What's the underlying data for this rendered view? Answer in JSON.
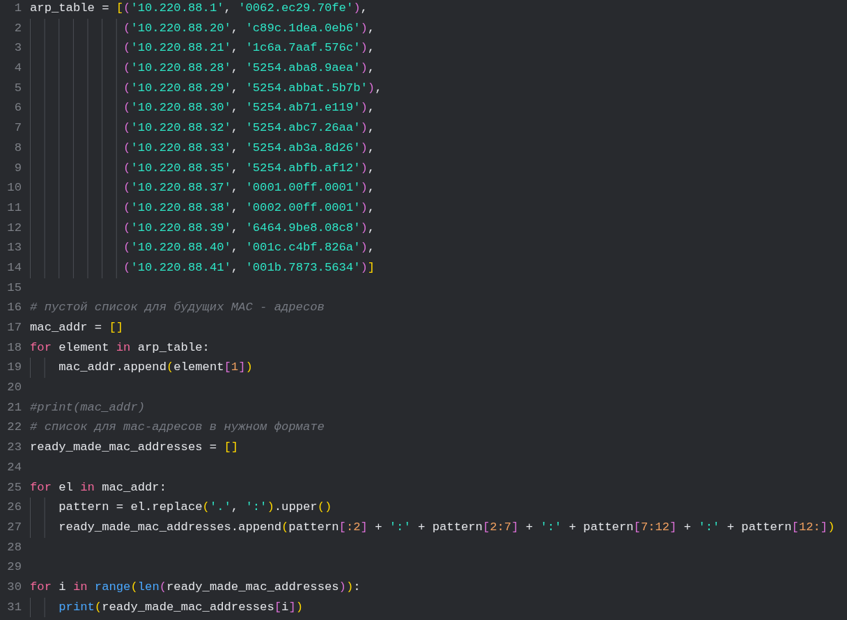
{
  "editor": {
    "lines": [
      {
        "number": "1",
        "tokens": [
          {
            "kind": "plain",
            "text": "arp_table = "
          },
          {
            "kind": "bracket1",
            "text": "["
          },
          {
            "kind": "bracket2",
            "text": "("
          },
          {
            "kind": "string",
            "text": "'10.220.88.1'"
          },
          {
            "kind": "plain",
            "text": ", "
          },
          {
            "kind": "string",
            "text": "'0062.ec29.70fe'"
          },
          {
            "kind": "bracket2",
            "text": ")"
          },
          {
            "kind": "plain",
            "text": ","
          }
        ]
      },
      {
        "number": "2",
        "tokens": [
          {
            "kind": "bracket2",
            "text": "             ("
          },
          {
            "kind": "string",
            "text": "'10.220.88.20'"
          },
          {
            "kind": "plain",
            "text": ", "
          },
          {
            "kind": "string",
            "text": "'c89c.1dea.0eb6'"
          },
          {
            "kind": "bracket2",
            "text": ")"
          },
          {
            "kind": "plain",
            "text": ","
          }
        ]
      },
      {
        "number": "3",
        "tokens": [
          {
            "kind": "bracket2",
            "text": "             ("
          },
          {
            "kind": "string",
            "text": "'10.220.88.21'"
          },
          {
            "kind": "plain",
            "text": ", "
          },
          {
            "kind": "string",
            "text": "'1c6a.7aaf.576c'"
          },
          {
            "kind": "bracket2",
            "text": ")"
          },
          {
            "kind": "plain",
            "text": ","
          }
        ]
      },
      {
        "number": "4",
        "tokens": [
          {
            "kind": "bracket2",
            "text": "             ("
          },
          {
            "kind": "string",
            "text": "'10.220.88.28'"
          },
          {
            "kind": "plain",
            "text": ", "
          },
          {
            "kind": "string",
            "text": "'5254.aba8.9aea'"
          },
          {
            "kind": "bracket2",
            "text": ")"
          },
          {
            "kind": "plain",
            "text": ","
          }
        ]
      },
      {
        "number": "5",
        "tokens": [
          {
            "kind": "bracket2",
            "text": "             ("
          },
          {
            "kind": "string",
            "text": "'10.220.88.29'"
          },
          {
            "kind": "plain",
            "text": ", "
          },
          {
            "kind": "string",
            "text": "'5254.abbat.5b7b'"
          },
          {
            "kind": "bracket2",
            "text": ")"
          },
          {
            "kind": "plain",
            "text": ","
          }
        ]
      },
      {
        "number": "6",
        "tokens": [
          {
            "kind": "bracket2",
            "text": "             ("
          },
          {
            "kind": "string",
            "text": "'10.220.88.30'"
          },
          {
            "kind": "plain",
            "text": ", "
          },
          {
            "kind": "string",
            "text": "'5254.ab71.e119'"
          },
          {
            "kind": "bracket2",
            "text": ")"
          },
          {
            "kind": "plain",
            "text": ","
          }
        ]
      },
      {
        "number": "7",
        "tokens": [
          {
            "kind": "bracket2",
            "text": "             ("
          },
          {
            "kind": "string",
            "text": "'10.220.88.32'"
          },
          {
            "kind": "plain",
            "text": ", "
          },
          {
            "kind": "string",
            "text": "'5254.abc7.26aa'"
          },
          {
            "kind": "bracket2",
            "text": ")"
          },
          {
            "kind": "plain",
            "text": ","
          }
        ]
      },
      {
        "number": "8",
        "tokens": [
          {
            "kind": "bracket2",
            "text": "             ("
          },
          {
            "kind": "string",
            "text": "'10.220.88.33'"
          },
          {
            "kind": "plain",
            "text": ", "
          },
          {
            "kind": "string",
            "text": "'5254.ab3a.8d26'"
          },
          {
            "kind": "bracket2",
            "text": ")"
          },
          {
            "kind": "plain",
            "text": ","
          }
        ]
      },
      {
        "number": "9",
        "tokens": [
          {
            "kind": "bracket2",
            "text": "             ("
          },
          {
            "kind": "string",
            "text": "'10.220.88.35'"
          },
          {
            "kind": "plain",
            "text": ", "
          },
          {
            "kind": "string",
            "text": "'5254.abfb.af12'"
          },
          {
            "kind": "bracket2",
            "text": ")"
          },
          {
            "kind": "plain",
            "text": ","
          }
        ]
      },
      {
        "number": "10",
        "tokens": [
          {
            "kind": "bracket2",
            "text": "             ("
          },
          {
            "kind": "string",
            "text": "'10.220.88.37'"
          },
          {
            "kind": "plain",
            "text": ", "
          },
          {
            "kind": "string",
            "text": "'0001.00ff.0001'"
          },
          {
            "kind": "bracket2",
            "text": ")"
          },
          {
            "kind": "plain",
            "text": ","
          }
        ]
      },
      {
        "number": "11",
        "tokens": [
          {
            "kind": "bracket2",
            "text": "             ("
          },
          {
            "kind": "string",
            "text": "'10.220.88.38'"
          },
          {
            "kind": "plain",
            "text": ", "
          },
          {
            "kind": "string",
            "text": "'0002.00ff.0001'"
          },
          {
            "kind": "bracket2",
            "text": ")"
          },
          {
            "kind": "plain",
            "text": ","
          }
        ]
      },
      {
        "number": "12",
        "tokens": [
          {
            "kind": "bracket2",
            "text": "             ("
          },
          {
            "kind": "string",
            "text": "'10.220.88.39'"
          },
          {
            "kind": "plain",
            "text": ", "
          },
          {
            "kind": "string",
            "text": "'6464.9be8.08c8'"
          },
          {
            "kind": "bracket2",
            "text": ")"
          },
          {
            "kind": "plain",
            "text": ","
          }
        ]
      },
      {
        "number": "13",
        "tokens": [
          {
            "kind": "bracket2",
            "text": "             ("
          },
          {
            "kind": "string",
            "text": "'10.220.88.40'"
          },
          {
            "kind": "plain",
            "text": ", "
          },
          {
            "kind": "string",
            "text": "'001c.c4bf.826a'"
          },
          {
            "kind": "bracket2",
            "text": ")"
          },
          {
            "kind": "plain",
            "text": ","
          }
        ]
      },
      {
        "number": "14",
        "tokens": [
          {
            "kind": "bracket2",
            "text": "             ("
          },
          {
            "kind": "string",
            "text": "'10.220.88.41'"
          },
          {
            "kind": "plain",
            "text": ", "
          },
          {
            "kind": "string",
            "text": "'001b.7873.5634'"
          },
          {
            "kind": "bracket2",
            "text": ")"
          },
          {
            "kind": "bracket1",
            "text": "]"
          }
        ]
      },
      {
        "number": "15"
      },
      {
        "number": "16",
        "tokens": [
          {
            "kind": "comment",
            "text": "# пустой список для будущих MAC - адресов"
          }
        ]
      },
      {
        "number": "17",
        "tokens": [
          {
            "kind": "plain",
            "text": "mac_addr = "
          },
          {
            "kind": "bracket1",
            "text": "[]"
          }
        ]
      },
      {
        "number": "18",
        "tokens": [
          {
            "kind": "keyword",
            "text": "for"
          },
          {
            "kind": "plain",
            "text": " element "
          },
          {
            "kind": "keyword",
            "text": "in"
          },
          {
            "kind": "plain",
            "text": " arp_table:"
          }
        ]
      },
      {
        "number": "19",
        "tokens": [
          {
            "kind": "plain",
            "text": "    mac_addr.append"
          },
          {
            "kind": "bracket1",
            "text": "("
          },
          {
            "kind": "plain",
            "text": "element"
          },
          {
            "kind": "bracket2",
            "text": "["
          },
          {
            "kind": "number",
            "text": "1"
          },
          {
            "kind": "bracket2",
            "text": "]"
          },
          {
            "kind": "bracket1",
            "text": ")"
          }
        ]
      },
      {
        "number": "20"
      },
      {
        "number": "21",
        "tokens": [
          {
            "kind": "comment",
            "text": "#print(mac_addr)"
          }
        ]
      },
      {
        "number": "22",
        "tokens": [
          {
            "kind": "comment",
            "text": "# список для mac-адресов в нужном формате"
          }
        ]
      },
      {
        "number": "23",
        "tokens": [
          {
            "kind": "plain",
            "text": "ready_made_mac_addresses = "
          },
          {
            "kind": "bracket1",
            "text": "[]"
          }
        ]
      },
      {
        "number": "24"
      },
      {
        "number": "25",
        "tokens": [
          {
            "kind": "keyword",
            "text": "for"
          },
          {
            "kind": "plain",
            "text": " el "
          },
          {
            "kind": "keyword",
            "text": "in"
          },
          {
            "kind": "plain",
            "text": " mac_addr:"
          }
        ]
      },
      {
        "number": "26",
        "tokens": [
          {
            "kind": "plain",
            "text": "    pattern = el.replace"
          },
          {
            "kind": "bracket1",
            "text": "("
          },
          {
            "kind": "string",
            "text": "'.'"
          },
          {
            "kind": "plain",
            "text": ", "
          },
          {
            "kind": "string",
            "text": "':'"
          },
          {
            "kind": "bracket1",
            "text": ")"
          },
          {
            "kind": "plain",
            "text": ".upper"
          },
          {
            "kind": "bracket1",
            "text": "()"
          }
        ]
      },
      {
        "number": "27",
        "tokens": [
          {
            "kind": "plain",
            "text": "    ready_made_mac_addresses.append"
          },
          {
            "kind": "bracket1",
            "text": "("
          },
          {
            "kind": "plain",
            "text": "pattern"
          },
          {
            "kind": "bracket2",
            "text": "["
          },
          {
            "kind": "number",
            "text": ":2"
          },
          {
            "kind": "bracket2",
            "text": "]"
          },
          {
            "kind": "plain",
            "text": " + "
          },
          {
            "kind": "string",
            "text": "':'"
          },
          {
            "kind": "plain",
            "text": " + pattern"
          },
          {
            "kind": "bracket2",
            "text": "["
          },
          {
            "kind": "number",
            "text": "2:7"
          },
          {
            "kind": "bracket2",
            "text": "]"
          },
          {
            "kind": "plain",
            "text": " + "
          },
          {
            "kind": "string",
            "text": "':'"
          },
          {
            "kind": "plain",
            "text": " + pattern"
          },
          {
            "kind": "bracket2",
            "text": "["
          },
          {
            "kind": "number",
            "text": "7:12"
          },
          {
            "kind": "bracket2",
            "text": "]"
          },
          {
            "kind": "plain",
            "text": " + "
          },
          {
            "kind": "string",
            "text": "':'"
          },
          {
            "kind": "plain",
            "text": " + pattern"
          },
          {
            "kind": "bracket2",
            "text": "["
          },
          {
            "kind": "number",
            "text": "12:"
          },
          {
            "kind": "bracket2",
            "text": "]"
          },
          {
            "kind": "bracket1",
            "text": ")"
          }
        ]
      },
      {
        "number": "28"
      },
      {
        "number": "29"
      },
      {
        "number": "30",
        "tokens": [
          {
            "kind": "keyword",
            "text": "for"
          },
          {
            "kind": "plain",
            "text": " i "
          },
          {
            "kind": "keyword",
            "text": "in"
          },
          {
            "kind": "builtin",
            "text": " range"
          },
          {
            "kind": "bracket1",
            "text": "("
          },
          {
            "kind": "builtin",
            "text": "len"
          },
          {
            "kind": "bracket2",
            "text": "("
          },
          {
            "kind": "plain",
            "text": "ready_made_mac_addresses"
          },
          {
            "kind": "bracket2",
            "text": ")"
          },
          {
            "kind": "bracket1",
            "text": ")"
          },
          {
            "kind": "plain",
            "text": ":"
          }
        ]
      },
      {
        "number": "31",
        "tokens": [
          {
            "kind": "builtin",
            "text": "    print"
          },
          {
            "kind": "bracket1",
            "text": "("
          },
          {
            "kind": "plain",
            "text": "ready_made_mac_addresses"
          },
          {
            "kind": "bracket2",
            "text": "["
          },
          {
            "kind": "plain",
            "text": "i"
          },
          {
            "kind": "bracket2",
            "text": "]"
          },
          {
            "kind": "bracket1",
            "text": ")"
          }
        ]
      }
    ]
  }
}
